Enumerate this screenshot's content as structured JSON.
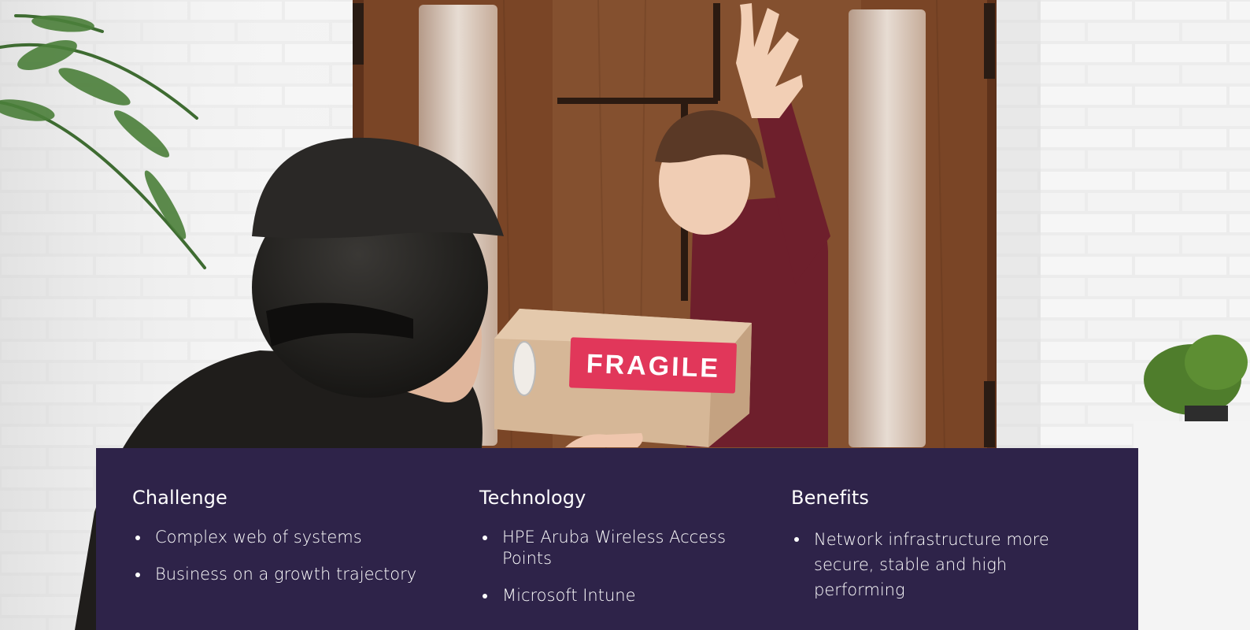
{
  "photo": {
    "box_label": "FRAGILE",
    "colors": {
      "brick": "#ededed",
      "door": "#7a4526",
      "door_dark": "#5e321b",
      "sweater": "#6e1f2c",
      "box": "#d3b596",
      "label": "#e1375a",
      "jacket": "#1f1d1b",
      "cap": "#2a2826",
      "fern": "#3e6b31"
    }
  },
  "panel": {
    "background": "#2e2349",
    "columns": [
      {
        "heading": "Challenge",
        "items": [
          "Complex web of systems",
          "Business on a growth trajectory"
        ]
      },
      {
        "heading": "Technology",
        "items": [
          "HPE Aruba Wireless Access Points",
          "Microsoft Intune"
        ]
      },
      {
        "heading": "Benefits",
        "items": [
          "Network infrastructure more secure, stable and high performing"
        ]
      }
    ]
  }
}
